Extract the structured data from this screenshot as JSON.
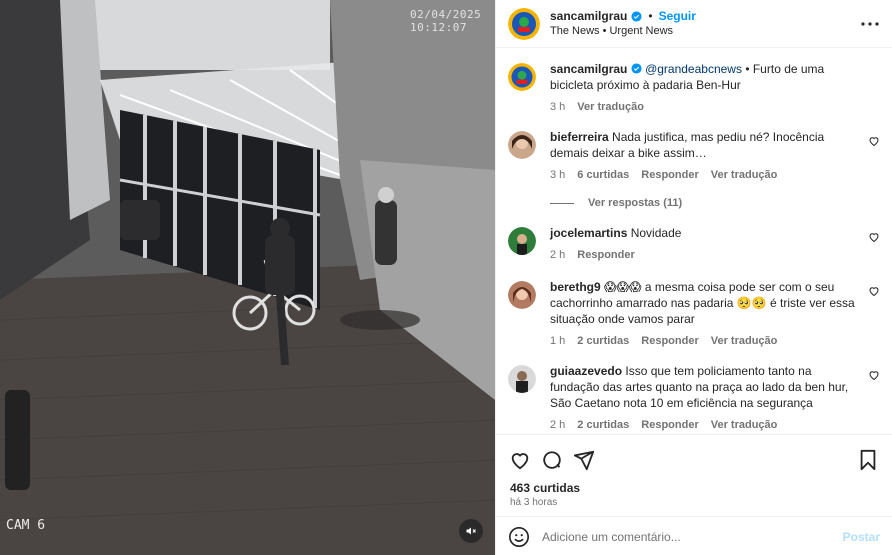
{
  "media": {
    "timestamp": "02/04/2025 10:12:07",
    "camera_label": "CAM 6",
    "mute_icon": "speaker-muted-icon"
  },
  "post_header": {
    "username": "sancamilgrau",
    "dot": "•",
    "follow_label": "Seguir",
    "subtitle": "The News • Urgent News",
    "more_icon": "more-horizontal-icon"
  },
  "caption": {
    "username": "sancamilgrau",
    "mention": "@grandeabcnews",
    "text": " • Furto de uma bicicleta próximo à padaria Ben-Hur",
    "time": "3 h",
    "see_translation": "Ver tradução"
  },
  "comments": [
    {
      "username": "bieferreira",
      "text": "Nada justifica, mas pediu né? Inocência demais deixar a bike assim…",
      "time": "3 h",
      "likes": "6 curtidas",
      "reply": "Responder",
      "translate": "Ver tradução",
      "view_replies": "Ver respostas (11)"
    },
    {
      "username": "jocelemartins",
      "text": "Novidade",
      "time": "2 h",
      "reply": "Responder"
    },
    {
      "username": "berethg9",
      "text": "😱😱😱 a mesma coisa pode ser com o seu cachorrinho amarrado nas padaria 🥺🥺 é triste ver essa situação onde vamos parar",
      "time": "1 h",
      "likes": "2 curtidas",
      "reply": "Responder",
      "translate": "Ver tradução"
    },
    {
      "username": "guiaazevedo",
      "text": "Isso que tem policiamento tanto na fundação das artes quanto na praça ao lado da ben hur, São Caetano nota 10 em eficiência na segurança",
      "time": "2 h",
      "likes": "2 curtidas",
      "reply": "Responder",
      "translate": "Ver tradução"
    }
  ],
  "actions": {
    "like_icon": "heart-icon",
    "comment_icon": "comment-icon",
    "share_icon": "share-icon",
    "save_icon": "bookmark-icon",
    "likes_count": "463 curtidas",
    "time_ago": "há 3 horas"
  },
  "add_comment": {
    "emoji_icon": "emoji-icon",
    "placeholder": "Adicione um comentário...",
    "post_label": "Postar"
  },
  "colors": {
    "accent_blue": "#0095f6",
    "muted_text": "#737373",
    "post_disabled": "#b2dffc",
    "verified": "#0095f6"
  }
}
